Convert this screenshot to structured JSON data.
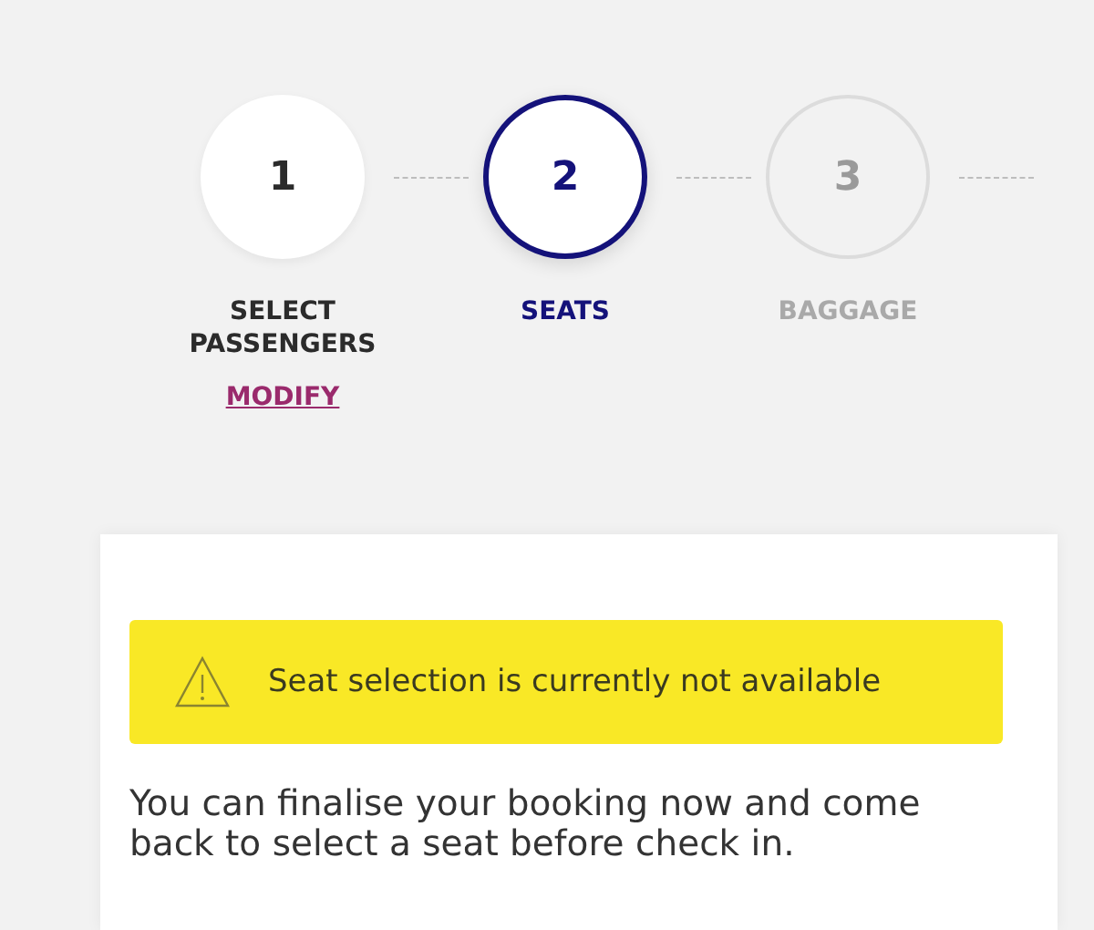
{
  "steps": [
    {
      "number": "1",
      "label": "SELECT PASSENGERS",
      "completed": true,
      "selected": false,
      "action": "MODIFY"
    },
    {
      "number": "2",
      "label": "SEATS",
      "completed": false,
      "selected": true
    },
    {
      "number": "3",
      "label": "BAGGAGE",
      "completed": false,
      "selected": false
    }
  ],
  "notice": {
    "message": "Seat selection is currently not available",
    "body": "You can finalise your booking now and come back to select a seat before check in."
  }
}
